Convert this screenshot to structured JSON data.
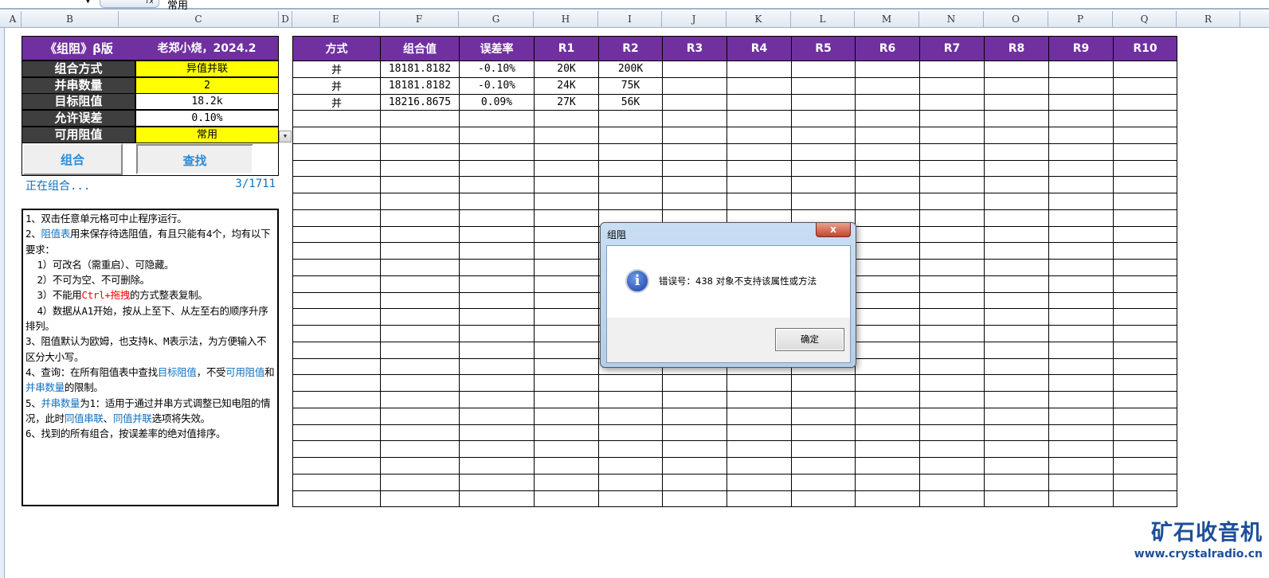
{
  "formula_bar": {
    "fx": "fx",
    "value": "常用"
  },
  "columns": [
    "A",
    "B",
    "C",
    "D",
    "E",
    "F",
    "G",
    "H",
    "I",
    "J",
    "K",
    "L",
    "M",
    "N",
    "O",
    "P",
    "Q",
    "R"
  ],
  "panel": {
    "title_left": "《组阻》β版",
    "title_right": "老郑小烧，2024.2",
    "rows": [
      {
        "label": "组合方式",
        "value": "异值并联"
      },
      {
        "label": "并串数量",
        "value": "2"
      },
      {
        "label": "目标阻值",
        "value": "18.2k"
      },
      {
        "label": "允许误差",
        "value": "0.10%"
      },
      {
        "label": "可用阻值",
        "value": "常用"
      }
    ],
    "combine_button": "组合",
    "find_button": "查找",
    "status": "正在组合...",
    "progress": "3/1711"
  },
  "notes": {
    "l1": "1、双击任意单元格可中止程序运行。",
    "l2a": "2、",
    "l2b": "阻值表",
    "l2c": "用来保存待选阻值，有且只能有4个，均有以下要求：",
    "l3": "  1）可改名（需重启）、可隐藏。",
    "l4": "  2）不可为空、不可删除。",
    "l5a": "  3）不能用",
    "l5b": "Ctrl+拖拽",
    "l5c": "的方式整表复制。",
    "l6": "  4）数据从A1开始，按从上至下、从左至右的顺序升序排列。",
    "l7": "3、阻值默认为欧姆，也支持k、M表示法，为方便输入不区分大小写。",
    "l8a": "4、查询：在所有阻值表中查找",
    "l8b": "目标阻值",
    "l8c": "，不受",
    "l8d": "可用阻值",
    "l8e": "和",
    "l8f": "并串数量",
    "l8g": "的限制。",
    "l9a": "5、",
    "l9b": "并串数量",
    "l9c": "为1：适用于通过并串方式调整已知电阻的情况，此时",
    "l9d": "同值串联",
    "l9e": "、",
    "l9f": "同值并联",
    "l9g": "选项将失效。",
    "l10": "6、找到的所有组合，按误差率的绝对值排序。"
  },
  "results": {
    "headers": [
      "方式",
      "组合值",
      "误差率",
      "R1",
      "R2",
      "R3",
      "R4",
      "R5",
      "R6",
      "R7",
      "R8",
      "R9",
      "R10"
    ],
    "rows": [
      [
        "并",
        "18181.8182",
        "-0.10%",
        "20K",
        "200K",
        "",
        "",
        "",
        "",
        "",
        "",
        "",
        ""
      ],
      [
        "并",
        "18181.8182",
        "-0.10%",
        "24K",
        "75K",
        "",
        "",
        "",
        "",
        "",
        "",
        "",
        ""
      ],
      [
        "并",
        "18216.8675",
        "0.09%",
        "27K",
        "56K",
        "",
        "",
        "",
        "",
        "",
        "",
        "",
        ""
      ]
    ]
  },
  "dialog": {
    "title": "组阻",
    "close": "x",
    "message": "错误号：438  对象不支持该属性或方法",
    "ok": "确定"
  },
  "logo": {
    "title": "矿石收音机",
    "url": "www.crystalradio.cn"
  }
}
